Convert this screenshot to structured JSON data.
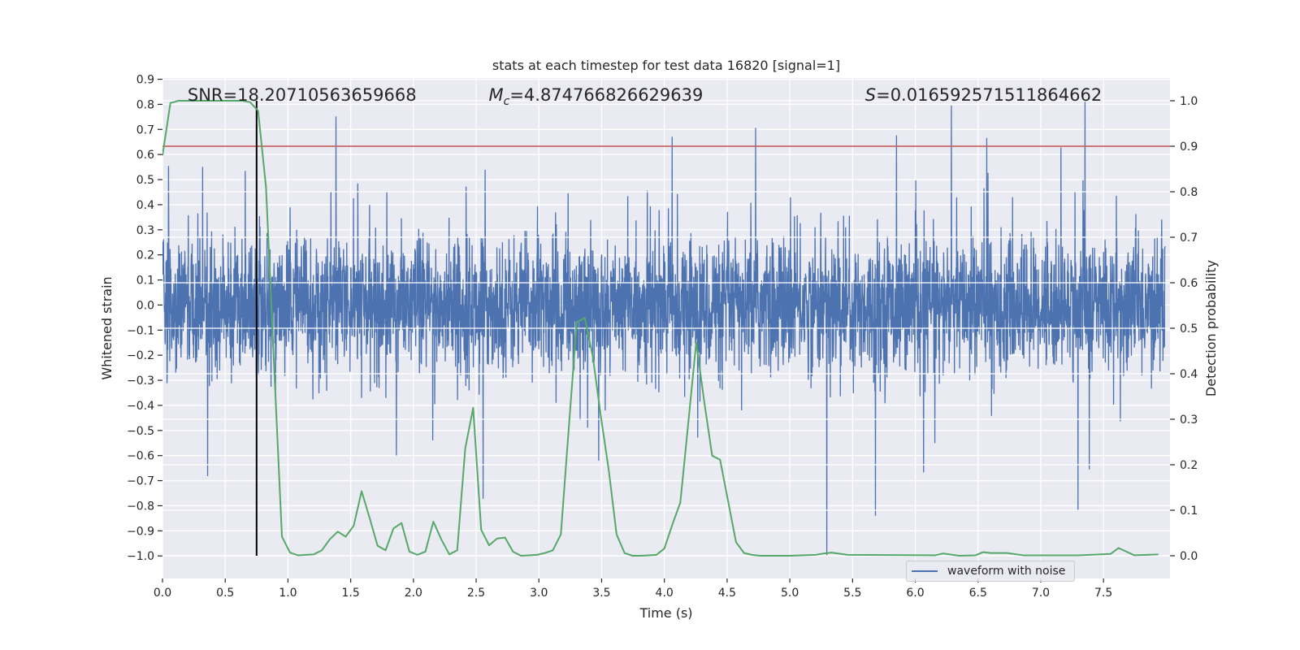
{
  "chart_data": {
    "type": "line",
    "title": "stats at each timestep for test data 16820 [signal=1]",
    "xlabel": "Time (s)",
    "ylabel": "Whitened strain",
    "ylabel_right": "Detection probability",
    "xlim": [
      0,
      8.03
    ],
    "ylim": [
      -1.09,
      0.905
    ],
    "ylim_right": [
      -0.05,
      1.05
    ],
    "grid": true,
    "background": "#EAEAF2",
    "x_ticks": [
      {
        "v": 0.0,
        "label": "0.0"
      },
      {
        "v": 0.5,
        "label": "0.5"
      },
      {
        "v": 1.0,
        "label": "1.0"
      },
      {
        "v": 1.5,
        "label": "1.5"
      },
      {
        "v": 2.0,
        "label": "2.0"
      },
      {
        "v": 2.5,
        "label": "2.5"
      },
      {
        "v": 3.0,
        "label": "3.0"
      },
      {
        "v": 3.5,
        "label": "3.5"
      },
      {
        "v": 4.0,
        "label": "4.0"
      },
      {
        "v": 4.5,
        "label": "4.5"
      },
      {
        "v": 5.0,
        "label": "5.0"
      },
      {
        "v": 5.5,
        "label": "5.5"
      },
      {
        "v": 6.0,
        "label": "6.0"
      },
      {
        "v": 6.5,
        "label": "6.5"
      },
      {
        "v": 7.0,
        "label": "7.0"
      },
      {
        "v": 7.5,
        "label": "7.5"
      }
    ],
    "y_ticks": [
      {
        "v": 0.9,
        "label": "0.9"
      },
      {
        "v": 0.8,
        "label": "0.8"
      },
      {
        "v": 0.7,
        "label": "0.7"
      },
      {
        "v": 0.6,
        "label": "0.6"
      },
      {
        "v": 0.5,
        "label": "0.5"
      },
      {
        "v": 0.4,
        "label": "0.4"
      },
      {
        "v": 0.3,
        "label": "0.3"
      },
      {
        "v": 0.2,
        "label": "0.2"
      },
      {
        "v": 0.1,
        "label": "0.1"
      },
      {
        "v": 0.0,
        "label": "0.0"
      },
      {
        "v": -0.1,
        "label": "−0.1"
      },
      {
        "v": -0.2,
        "label": "−0.2"
      },
      {
        "v": -0.3,
        "label": "−0.3"
      },
      {
        "v": -0.4,
        "label": "−0.4"
      },
      {
        "v": -0.5,
        "label": "−0.5"
      },
      {
        "v": -0.6,
        "label": "−0.6"
      },
      {
        "v": -0.7,
        "label": "−0.7"
      },
      {
        "v": -0.8,
        "label": "−0.8"
      },
      {
        "v": -0.9,
        "label": "−0.9"
      },
      {
        "v": -1.0,
        "label": "−1.0"
      }
    ],
    "y_ticks_right": [
      {
        "v": 0.0,
        "label": "0.0"
      },
      {
        "v": 0.1,
        "label": "0.1"
      },
      {
        "v": 0.2,
        "label": "0.2"
      },
      {
        "v": 0.3,
        "label": "0.3"
      },
      {
        "v": 0.4,
        "label": "0.4"
      },
      {
        "v": 0.5,
        "label": "0.5"
      },
      {
        "v": 0.6,
        "label": "0.6"
      },
      {
        "v": 0.7,
        "label": "0.7"
      },
      {
        "v": 0.8,
        "label": "0.8"
      },
      {
        "v": 0.9,
        "label": "0.9"
      },
      {
        "v": 1.0,
        "label": "1.0"
      }
    ],
    "annotations": [
      {
        "text": "SNR=18.20710563659668",
        "x": 0.2,
        "y_right": 1.0
      },
      {
        "text_italic": "M",
        "sub": "c",
        "text": "=4.874766826629639",
        "x": 2.6,
        "y_right": 1.0
      },
      {
        "text_italic": "S",
        "text": "=0.016592571511864662",
        "x": 5.6,
        "y_right": 1.0
      }
    ],
    "series": [
      {
        "name": "waveform with noise",
        "axis": "left",
        "color": "#4C72B0",
        "kind": "noise",
        "observed_range": [
          -1.0,
          0.81
        ]
      },
      {
        "axis": "right",
        "color": "#55A868",
        "points": [
          [
            0,
            0.88
          ],
          [
            0.063,
            0.995
          ],
          [
            0.127,
            1.0
          ],
          [
            0.19,
            1.0
          ],
          [
            0.254,
            1.0
          ],
          [
            0.317,
            1.0
          ],
          [
            0.381,
            1.0
          ],
          [
            0.444,
            1.0
          ],
          [
            0.508,
            1.0
          ],
          [
            0.571,
            1.0
          ],
          [
            0.635,
            1.0
          ],
          [
            0.698,
            0.997
          ],
          [
            0.762,
            0.978
          ],
          [
            0.825,
            0.81
          ],
          [
            0.889,
            0.42
          ],
          [
            0.952,
            0.042
          ],
          [
            1.016,
            0.007
          ],
          [
            1.079,
            0.001
          ],
          [
            1.143,
            0.002
          ],
          [
            1.206,
            0.003
          ],
          [
            1.27,
            0.012
          ],
          [
            1.333,
            0.036
          ],
          [
            1.397,
            0.053
          ],
          [
            1.46,
            0.042
          ],
          [
            1.524,
            0.066
          ],
          [
            1.587,
            0.142
          ],
          [
            1.651,
            0.083
          ],
          [
            1.714,
            0.022
          ],
          [
            1.778,
            0.012
          ],
          [
            1.841,
            0.06
          ],
          [
            1.905,
            0.072
          ],
          [
            1.968,
            0.009
          ],
          [
            2.032,
            0.002
          ],
          [
            2.095,
            0.009
          ],
          [
            2.159,
            0.075
          ],
          [
            2.222,
            0.036
          ],
          [
            2.286,
            0.003
          ],
          [
            2.349,
            0.012
          ],
          [
            2.413,
            0.236
          ],
          [
            2.476,
            0.325
          ],
          [
            2.54,
            0.057
          ],
          [
            2.603,
            0.023
          ],
          [
            2.667,
            0.038
          ],
          [
            2.73,
            0.04
          ],
          [
            2.794,
            0.009
          ],
          [
            2.857,
            0.0
          ],
          [
            2.921,
            0.001
          ],
          [
            2.984,
            0.002
          ],
          [
            3.048,
            0.006
          ],
          [
            3.111,
            0.012
          ],
          [
            3.175,
            0.047
          ],
          [
            3.238,
            0.28
          ],
          [
            3.302,
            0.513
          ],
          [
            3.365,
            0.523
          ],
          [
            3.429,
            0.439
          ],
          [
            3.492,
            0.31
          ],
          [
            3.556,
            0.19
          ],
          [
            3.619,
            0.047
          ],
          [
            3.683,
            0.006
          ],
          [
            3.746,
            0.0
          ],
          [
            3.81,
            0.0
          ],
          [
            3.873,
            0.001
          ],
          [
            3.937,
            0.002
          ],
          [
            4.0,
            0.016
          ],
          [
            4.063,
            0.068
          ],
          [
            4.127,
            0.117
          ],
          [
            4.19,
            0.29
          ],
          [
            4.254,
            0.469
          ],
          [
            4.317,
            0.34
          ],
          [
            4.381,
            0.22
          ],
          [
            4.444,
            0.211
          ],
          [
            4.508,
            0.12
          ],
          [
            4.571,
            0.03
          ],
          [
            4.635,
            0.006
          ],
          [
            4.698,
            0.002
          ],
          [
            4.762,
            0.0
          ],
          [
            5.0,
            0.0
          ],
          [
            5.206,
            0.002
          ],
          [
            5.27,
            0.005
          ],
          [
            5.333,
            0.007
          ],
          [
            5.46,
            0.002
          ],
          [
            6.16,
            0.001
          ],
          [
            6.222,
            0.005
          ],
          [
            6.35,
            0.0
          ],
          [
            6.48,
            0.001
          ],
          [
            6.54,
            0.008
          ],
          [
            6.6,
            0.006
          ],
          [
            6.73,
            0.006
          ],
          [
            6.86,
            0.001
          ],
          [
            7.3,
            0.001
          ],
          [
            7.556,
            0.004
          ],
          [
            7.62,
            0.017
          ],
          [
            7.746,
            0.001
          ],
          [
            7.937,
            0.003
          ]
        ]
      }
    ],
    "threshold_line": {
      "axis": "right",
      "y": 0.9,
      "color": "#C44E52"
    },
    "marker_line": {
      "axis": "right",
      "x": 0.75,
      "y_range": [
        0,
        1
      ],
      "color": "#000000"
    },
    "legend": {
      "placement": "lower-right",
      "entries": [
        "waveform with noise"
      ]
    }
  }
}
